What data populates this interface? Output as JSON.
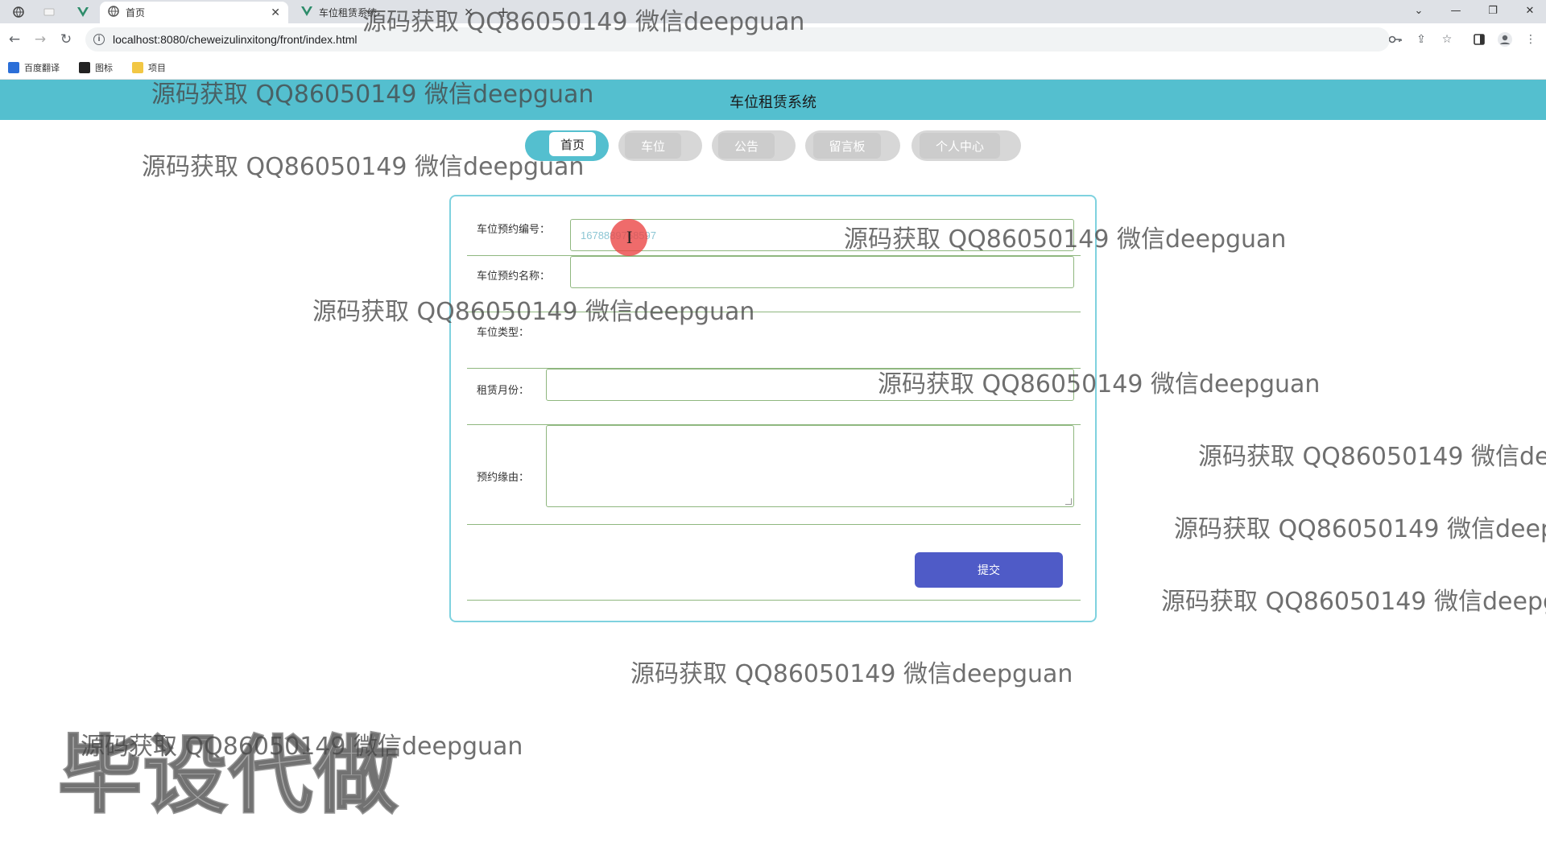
{
  "browser": {
    "tabs": [
      {
        "title": "首页",
        "active": true,
        "icon": "globe-icon"
      },
      {
        "title": "车位租赁系统",
        "active": false,
        "icon": "vue-icon"
      }
    ],
    "url": "localhost:8080/cheweizulinxitong/front/index.html",
    "bookmarks": [
      {
        "label": "百度翻译",
        "icon": "translate-icon",
        "color": "#2b6fd8"
      },
      {
        "label": "图标",
        "icon": "image-icon",
        "color": "#222222"
      },
      {
        "label": "项目",
        "icon": "folder-icon",
        "color": "#f2c744"
      }
    ]
  },
  "site": {
    "title": "车位租赁系统",
    "nav": [
      "首页",
      "车位",
      "公告",
      "留言板",
      "个人中心"
    ],
    "accent": "#54bfcf"
  },
  "form": {
    "fields": {
      "booking_no": {
        "label": "车位预约编号：",
        "value": "1678889768597"
      },
      "booking_name": {
        "label": "车位预约名称：",
        "value": ""
      },
      "space_type": {
        "label": "车位类型："
      },
      "rent_months": {
        "label": "租赁月份：",
        "value": ""
      },
      "reason": {
        "label": "预约缘由：",
        "value": ""
      }
    },
    "submit_label": "提交",
    "submit_color": "#4f5bc7"
  },
  "watermarks": {
    "text": "源码获取 QQ86050149 微信deepguan",
    "stamp": "毕设代做"
  }
}
